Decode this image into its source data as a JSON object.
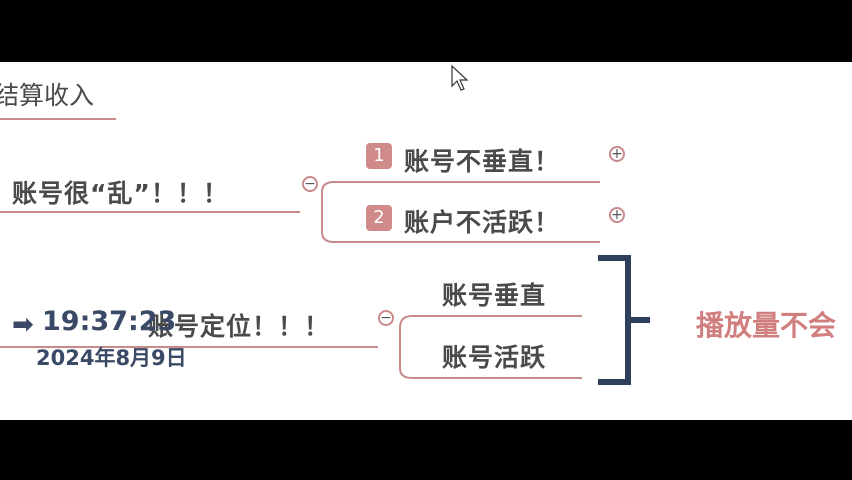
{
  "heading": "结算收入",
  "branch1": {
    "label": "账号很“乱”！！！",
    "children": [
      {
        "number": "1",
        "label": "账号不垂直！"
      },
      {
        "number": "2",
        "label": "账户不活跃！"
      }
    ]
  },
  "branch2": {
    "label": "账号定位！！！",
    "children": [
      {
        "label": "账号垂直"
      },
      {
        "label": "账号活跃"
      }
    ]
  },
  "result": "播放量不会",
  "overlay": {
    "time": "19:37:23",
    "date": "2024年8月9日"
  },
  "icons": {
    "expand": "plus-circle-icon",
    "collapse": "minus-circle-icon",
    "cursor": "mouse-cursor-icon",
    "arrow": "right-arrow-icon"
  },
  "colors": {
    "accent": "#c98a8a",
    "badge": "#d08a8a",
    "result": "#d07e7e",
    "bracket": "#2e3f5c"
  }
}
